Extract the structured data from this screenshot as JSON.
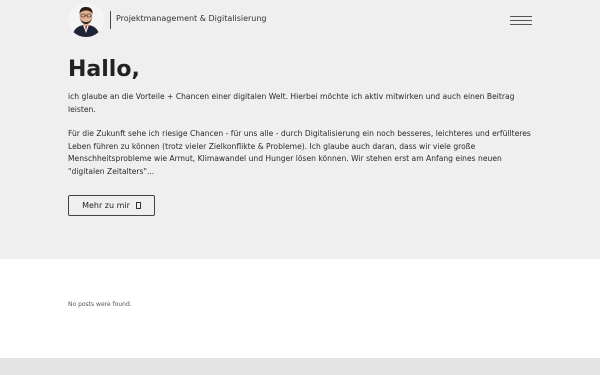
{
  "header": {
    "tagline": "Projektmanagement & Digitalisierung",
    "menu_icon": "hamburger-menu-icon"
  },
  "hero": {
    "heading": "Hallo,",
    "paragraph1": "ich glaube an die Vorteile + Chancen einer digitalen Welt. Hierbei möchte ich aktiv mitwirken und auch einen Beitrag leisten.",
    "paragraph2": "Für die Zukunft sehe ich riesige Chancen - für uns alle - durch Digitalisierung ein noch besseres, leichteres und erfüllteres Leben führen zu können (trotz vieler Zielkonflikte & Probleme). Ich glaube auch daran, dass wir viele große Menschheitsprobleme wie Armut, Klimawandel und Hunger lösen können. Wir stehen erst am Anfang eines neuen \"digitalen Zeitalters\"...",
    "button_label": "Mehr zu mir"
  },
  "posts": {
    "empty_message": "No posts were found."
  },
  "colors": {
    "hero_background": "#efefef",
    "footer_background": "#e3e3e3",
    "text": "#222222"
  }
}
